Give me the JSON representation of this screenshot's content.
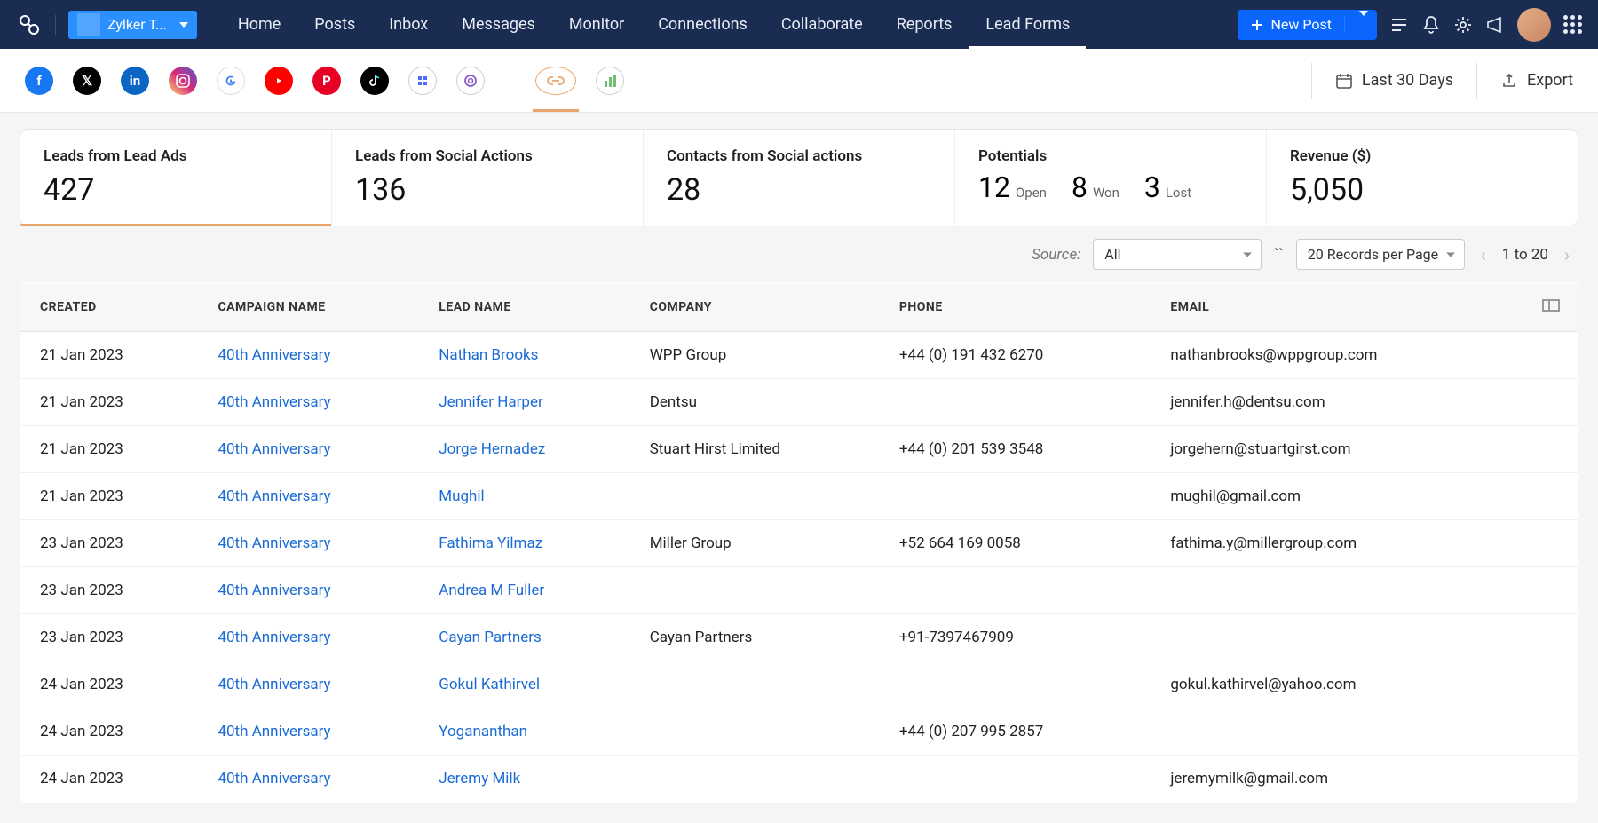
{
  "header": {
    "brand_name": "Zylker T...",
    "tabs": [
      "Home",
      "Posts",
      "Inbox",
      "Messages",
      "Monitor",
      "Connections",
      "Collaborate",
      "Reports",
      "Lead Forms"
    ],
    "active_tab": 8,
    "new_post_label": "New Post"
  },
  "channels": {
    "names": [
      "facebook",
      "x-twitter",
      "linkedin",
      "instagram",
      "google",
      "youtube",
      "pinterest",
      "tiktok",
      "grid",
      "threads"
    ],
    "link_icon": "link",
    "last_icon": "chart"
  },
  "date_filter": "Last 30 Days",
  "export_label": "Export",
  "metrics": {
    "cards": [
      {
        "title": "Leads from Lead Ads",
        "value": "427",
        "active": true
      },
      {
        "title": "Leads from Social Actions",
        "value": "136"
      },
      {
        "title": "Contacts from Social actions",
        "value": "28"
      },
      {
        "title": "Potentials",
        "potentials": [
          {
            "n": "12",
            "l": "Open"
          },
          {
            "n": "8",
            "l": "Won"
          },
          {
            "n": "3",
            "l": "Lost"
          }
        ]
      },
      {
        "title": "Revenue ($)",
        "value": "5,050"
      }
    ]
  },
  "controls": {
    "source_label": "Source:",
    "source_value": "All",
    "page_size": "20 Records per Page",
    "range": "1 to 20"
  },
  "table": {
    "headers": [
      "CREATED",
      "CAMPAIGN NAME",
      "LEAD NAME",
      "COMPANY",
      "PHONE",
      "EMAIL"
    ],
    "rows": [
      {
        "created": "21 Jan 2023",
        "campaign": "40th Anniversary",
        "lead": "Nathan Brooks",
        "company": "WPP Group",
        "phone": "+44 (0) 191 432 6270",
        "email": "nathanbrooks@wppgroup.com"
      },
      {
        "created": "21 Jan 2023",
        "campaign": "40th Anniversary",
        "lead": "Jennifer Harper",
        "company": "Dentsu",
        "phone": "",
        "email": "jennifer.h@dentsu.com"
      },
      {
        "created": "21 Jan 2023",
        "campaign": "40th Anniversary",
        "lead": "Jorge Hernadez",
        "company": "Stuart Hirst Limited",
        "phone": "+44 (0) 201 539 3548",
        "email": "jorgehern@stuartgirst.com"
      },
      {
        "created": "21 Jan 2023",
        "campaign": "40th Anniversary",
        "lead": "Mughil",
        "company": "",
        "phone": "",
        "email": "mughil@gmail.com"
      },
      {
        "created": "23 Jan 2023",
        "campaign": "40th Anniversary",
        "lead": "Fathima Yilmaz",
        "company": "Miller Group",
        "phone": "+52 664 169 0058",
        "email": "fathima.y@millergroup.com"
      },
      {
        "created": "23 Jan 2023",
        "campaign": "40th Anniversary",
        "lead": "Andrea M Fuller",
        "company": "",
        "phone": "",
        "email": ""
      },
      {
        "created": "23 Jan 2023",
        "campaign": "40th Anniversary",
        "lead": "Cayan Partners",
        "company": "Cayan Partners",
        "phone": "+91-7397467909",
        "email": ""
      },
      {
        "created": "24 Jan 2023",
        "campaign": "40th Anniversary",
        "lead": "Gokul Kathirvel",
        "company": "",
        "phone": "",
        "email": "gokul.kathirvel@yahoo.com"
      },
      {
        "created": "24 Jan 2023",
        "campaign": "40th Anniversary",
        "lead": "Yogananthan",
        "company": "",
        "phone": "+44 (0) 207 995 2857",
        "email": ""
      },
      {
        "created": "24 Jan 2023",
        "campaign": "40th Anniversary",
        "lead": "Jeremy Milk",
        "company": "",
        "phone": "",
        "email": "jeremymilk@gmail.com"
      }
    ]
  }
}
